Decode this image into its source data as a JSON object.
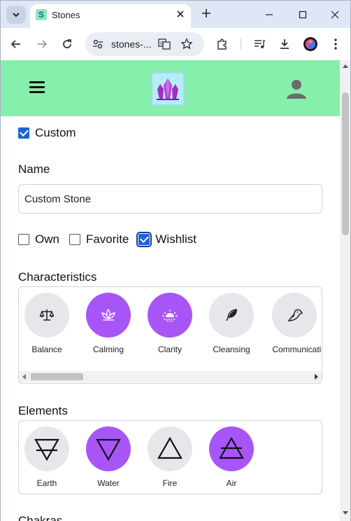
{
  "browser": {
    "tab_title": "Stones",
    "favicon_letter": "S",
    "url": "stones-..."
  },
  "app": {
    "custom_label": "Custom",
    "custom_checked": true,
    "name_heading": "Name",
    "name_value": "Custom Stone",
    "flags": [
      {
        "label": "Own",
        "checked": false
      },
      {
        "label": "Favorite",
        "checked": false
      },
      {
        "label": "Wishlist",
        "checked": true
      }
    ],
    "characteristics_heading": "Characteristics",
    "characteristics": [
      {
        "label": "Balance",
        "icon": "scale-icon",
        "active": false
      },
      {
        "label": "Calming",
        "icon": "lotus-icon",
        "active": true
      },
      {
        "label": "Clarity",
        "icon": "sunrise-icon",
        "active": true
      },
      {
        "label": "Cleansing",
        "icon": "feather-icon",
        "active": false
      },
      {
        "label": "Communication",
        "icon": "bird-icon",
        "active": false
      }
    ],
    "elements_heading": "Elements",
    "elements": [
      {
        "label": "Earth",
        "icon": "earth-symbol-icon",
        "active": false
      },
      {
        "label": "Water",
        "icon": "water-symbol-icon",
        "active": true
      },
      {
        "label": "Fire",
        "icon": "fire-symbol-icon",
        "active": false
      },
      {
        "label": "Air",
        "icon": "air-symbol-icon",
        "active": true
      }
    ],
    "chakras_heading": "Chakras"
  },
  "colors": {
    "header_bg": "#86efac",
    "active_chip": "#a855f7",
    "inactive_chip": "#e5e7eb",
    "checkbox_blue": "#1c64d8"
  }
}
